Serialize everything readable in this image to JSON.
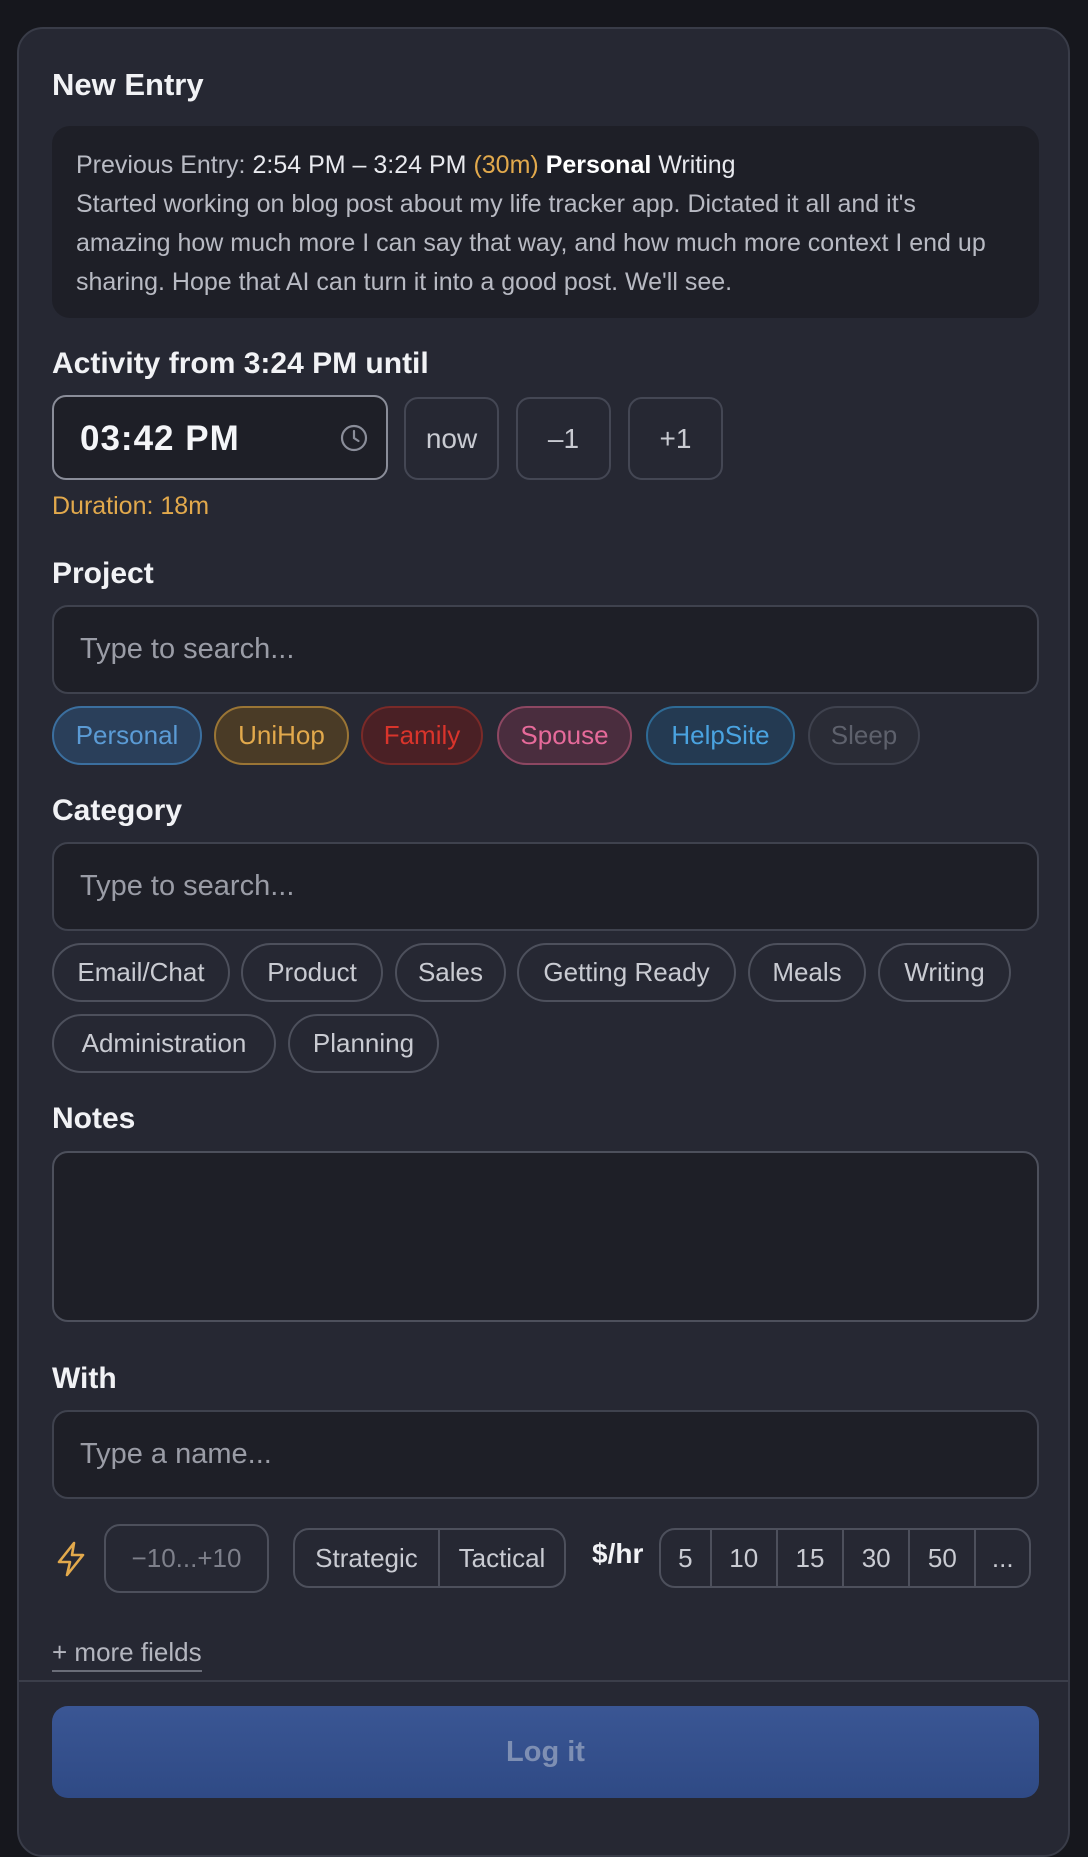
{
  "header": {
    "title": "New Entry"
  },
  "previous": {
    "label": "Previous Entry:",
    "time_range": "2:54 PM – 3:24 PM",
    "duration": "(30m)",
    "project": "Personal",
    "category": "Writing",
    "notes": "Started working on blog post about my life tracker app. Dictated it all and it's amazing how much more I can say that way, and how much more context I end up sharing. Hope that AI can turn it into a good post. We'll see."
  },
  "activity": {
    "label": "Activity from 3:24 PM until",
    "time_value": "03:42 PM",
    "buttons": [
      "now",
      "–1",
      "+1"
    ],
    "duration": "Duration: 18m"
  },
  "project": {
    "label": "Project",
    "placeholder": "Type to search...",
    "chips": [
      {
        "label": "Personal",
        "color": "#5b9bd5"
      },
      {
        "label": "UniHop",
        "color": "#e2a94c"
      },
      {
        "label": "Family",
        "color": "#d9342b"
      },
      {
        "label": "Spouse",
        "color": "#e66a9a"
      },
      {
        "label": "HelpSite",
        "color": "#4aa3e0"
      },
      {
        "label": "Sleep",
        "color": "#5e616c"
      }
    ]
  },
  "category": {
    "label": "Category",
    "placeholder": "Type to search...",
    "chips": [
      "Email/Chat",
      "Product",
      "Sales",
      "Getting Ready",
      "Meals",
      "Writing",
      "Administration",
      "Planning"
    ]
  },
  "notes": {
    "label": "Notes",
    "value": ""
  },
  "with": {
    "label": "With",
    "placeholder": "Type a name..."
  },
  "extras": {
    "energy_icon": "lightning-bolt-icon",
    "energy_placeholder": "−10...+10",
    "strategy": [
      "Strategic",
      "Tactical"
    ],
    "rate_label": "$/hr",
    "rates": [
      "5",
      "10",
      "15",
      "30",
      "50",
      "..."
    ]
  },
  "more_fields": "+ more fields",
  "submit": "Log it"
}
